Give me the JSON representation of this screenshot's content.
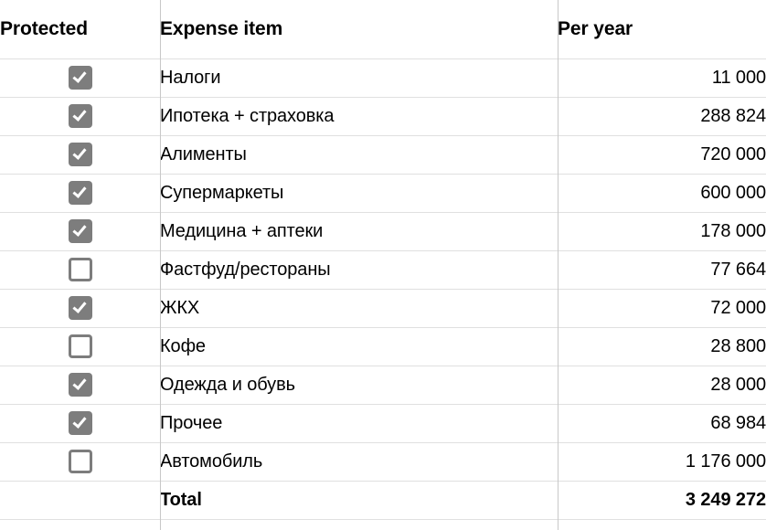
{
  "table": {
    "columns": {
      "protected": "Protected",
      "item": "Expense item",
      "year": "Per year"
    },
    "rows": [
      {
        "protected": true,
        "item": "Налоги",
        "year": "11 000"
      },
      {
        "protected": true,
        "item": "Ипотека + страховка",
        "year": "288 824"
      },
      {
        "protected": true,
        "item": "Алименты",
        "year": "720 000"
      },
      {
        "protected": true,
        "item": "Супермаркеты",
        "year": "600 000"
      },
      {
        "protected": true,
        "item": "Медицина + аптеки",
        "year": "178 000"
      },
      {
        "protected": false,
        "item": "Фастфуд/рестораны",
        "year": "77 664"
      },
      {
        "protected": true,
        "item": "ЖКХ",
        "year": "72 000"
      },
      {
        "protected": false,
        "item": "Кофе",
        "year": "28 800"
      },
      {
        "protected": true,
        "item": "Одежда и обувь",
        "year": "28 000"
      },
      {
        "protected": true,
        "item": "Прочее",
        "year": "68 984"
      },
      {
        "protected": false,
        "item": "Автомобиль",
        "year": "1 176 000"
      }
    ],
    "total": {
      "item": "Total",
      "year": "3 249 272"
    }
  },
  "colors": {
    "checkbox_fill": "#7d7d7d",
    "checkbox_border": "#7d7d7d",
    "row_divider": "#e0e0e0",
    "column_divider": "#c8c8c8",
    "text": "#000000",
    "background": "#ffffff"
  },
  "icons": {
    "checked": "checkbox-checked-icon",
    "unchecked": "checkbox-unchecked-icon"
  }
}
